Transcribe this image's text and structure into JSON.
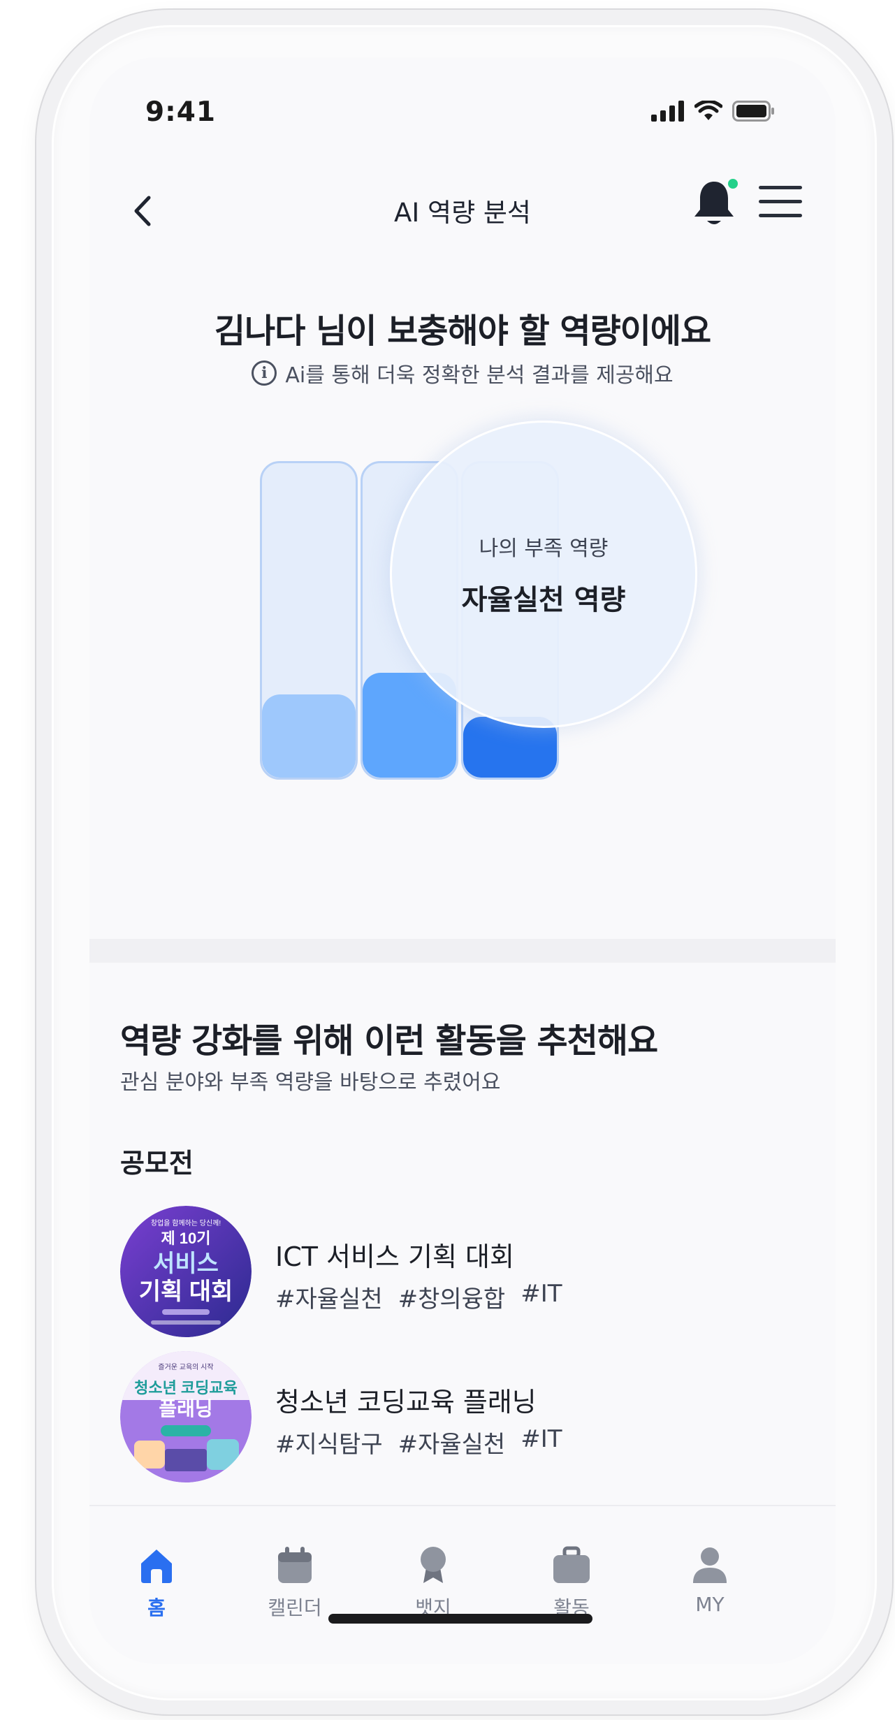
{
  "status_bar": {
    "time": "9:41"
  },
  "header": {
    "title": "AI 역량 분석"
  },
  "analysis": {
    "title": "김나다 님이 보충해야 할 역량이에요",
    "subtitle": "Ai를 통해 더욱 정확한 분석 결과를 제공해요",
    "focus_label": "나의 부족 역량",
    "focus_value": "자율실천 역량",
    "bars": [
      {
        "fill_fraction": 0.26,
        "color": "#9ec8fc"
      },
      {
        "fill_fraction": 0.33,
        "color": "#5ea6fd"
      },
      {
        "fill_fraction": 0.19,
        "color": "#2674ee"
      }
    ]
  },
  "recommend": {
    "title": "역량 강화를 위해 이런 활동을 추천해요",
    "subtitle": "관심 분야와 부족 역량을 바탕으로 추렸어요",
    "category": "공모전",
    "items": [
      {
        "name": "ICT 서비스 기획 대회",
        "tags": [
          "#자율실천",
          "#창의융합",
          "#IT"
        ],
        "thumb_lines": [
          "창업을 함께하는 당신께!",
          "제 10기",
          "서비스",
          "기획 대회"
        ]
      },
      {
        "name": "청소년 코딩교육 플래닝",
        "tags": [
          "#지식탐구",
          "#자율실천",
          "#IT"
        ],
        "thumb_lines": [
          "즐거운 교육의 시작",
          "청소년 코딩교육",
          "플래닝"
        ]
      }
    ]
  },
  "tabbar": {
    "tabs": [
      {
        "label": "홈",
        "icon": "home-icon",
        "active": true
      },
      {
        "label": "캘린더",
        "icon": "calendar-icon",
        "active": false
      },
      {
        "label": "뱃지",
        "icon": "badge-icon",
        "active": false
      },
      {
        "label": "활동",
        "icon": "briefcase-icon",
        "active": false
      },
      {
        "label": "MY",
        "icon": "person-icon",
        "active": false
      }
    ]
  },
  "colors": {
    "accent": "#2a6ff0",
    "notification_dot": "#24d18a",
    "thumb1_bg": "#4b2fa8",
    "thumb2_bg": "#9b6fe0"
  }
}
